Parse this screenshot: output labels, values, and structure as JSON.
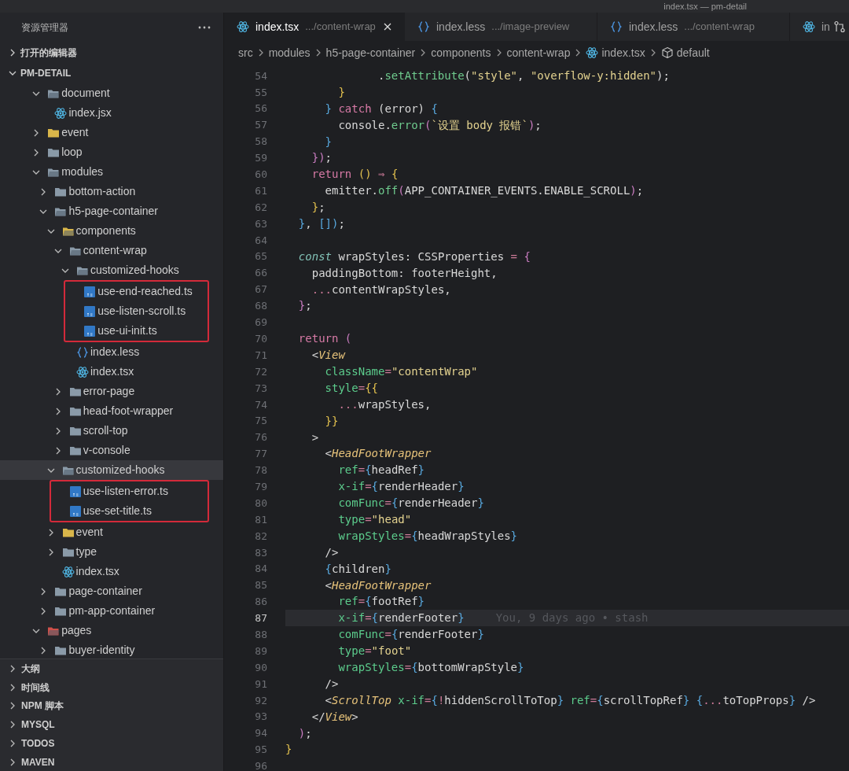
{
  "window": {
    "title": "index.tsx — pm-detail"
  },
  "sidebar": {
    "title": "资源管理器",
    "sections": [
      {
        "label": "打开的编辑器",
        "expanded": false
      },
      {
        "label": "PM-DETAIL",
        "expanded": true
      }
    ],
    "tree": [
      {
        "label": "document",
        "kind": "folder",
        "expanded": true,
        "selected": false,
        "boxed": false,
        "children": [
          {
            "label": "index.jsx",
            "kind": "react-file",
            "selected": false,
            "boxed": false
          }
        ]
      },
      {
        "label": "event",
        "kind": "folder",
        "color": "#d9b64a",
        "expanded": false,
        "selected": false,
        "boxed": false
      },
      {
        "label": "loop",
        "kind": "folder",
        "expanded": false,
        "selected": false,
        "boxed": false
      },
      {
        "label": "modules",
        "kind": "folder",
        "expanded": true,
        "selected": false,
        "boxed": false,
        "children": [
          {
            "label": "bottom-action",
            "kind": "folder",
            "expanded": false,
            "selected": false,
            "boxed": false
          },
          {
            "label": "h5-page-container",
            "kind": "folder",
            "expanded": true,
            "selected": false,
            "boxed": false,
            "children": [
              {
                "label": "components",
                "kind": "folder",
                "color": "#d9b64a",
                "expanded": true,
                "selected": false,
                "boxed": false,
                "children": [
                  {
                    "label": "content-wrap",
                    "kind": "folder",
                    "expanded": true,
                    "selected": false,
                    "boxed": false,
                    "children": [
                      {
                        "label": "customized-hooks",
                        "kind": "folder",
                        "expanded": true,
                        "selected": false,
                        "boxed": false,
                        "children": [
                          {
                            "label": "use-end-reached.ts",
                            "kind": "ts-file",
                            "selected": false,
                            "boxed": true
                          },
                          {
                            "label": "use-listen-scroll.ts",
                            "kind": "ts-file",
                            "selected": false,
                            "boxed": true
                          },
                          {
                            "label": "use-ui-init.ts",
                            "kind": "ts-file",
                            "selected": false,
                            "boxed": true
                          }
                        ]
                      },
                      {
                        "label": "index.less",
                        "kind": "less-file",
                        "selected": false,
                        "boxed": false
                      },
                      {
                        "label": "index.tsx",
                        "kind": "react-file",
                        "selected": false,
                        "boxed": false
                      }
                    ]
                  },
                  {
                    "label": "error-page",
                    "kind": "folder",
                    "expanded": false,
                    "selected": false,
                    "boxed": false
                  },
                  {
                    "label": "head-foot-wrapper",
                    "kind": "folder",
                    "expanded": false,
                    "selected": false,
                    "boxed": false
                  },
                  {
                    "label": "scroll-top",
                    "kind": "folder",
                    "expanded": false,
                    "selected": false,
                    "boxed": false
                  },
                  {
                    "label": "v-console",
                    "kind": "folder",
                    "expanded": false,
                    "selected": false,
                    "boxed": false
                  }
                ]
              },
              {
                "label": "customized-hooks",
                "kind": "folder",
                "expanded": true,
                "selected": true,
                "boxed": false,
                "children": [
                  {
                    "label": "use-listen-error.ts",
                    "kind": "ts-file",
                    "selected": false,
                    "boxed": true
                  },
                  {
                    "label": "use-set-title.ts",
                    "kind": "ts-file",
                    "selected": false,
                    "boxed": true
                  }
                ]
              },
              {
                "label": "event",
                "kind": "folder",
                "color": "#d9b64a",
                "expanded": false,
                "selected": false,
                "boxed": false
              },
              {
                "label": "type",
                "kind": "folder",
                "expanded": false,
                "selected": false,
                "boxed": false
              },
              {
                "label": "index.tsx",
                "kind": "react-file",
                "selected": false,
                "boxed": false
              }
            ]
          },
          {
            "label": "page-container",
            "kind": "folder",
            "expanded": false,
            "selected": false,
            "boxed": false
          },
          {
            "label": "pm-app-container",
            "kind": "folder",
            "expanded": false,
            "selected": false,
            "boxed": false
          }
        ]
      },
      {
        "label": "pages",
        "kind": "folder",
        "color": "#d0504a",
        "expanded": true,
        "selected": false,
        "boxed": false,
        "children": [
          {
            "label": "buyer-identity",
            "kind": "folder",
            "expanded": false,
            "selected": false,
            "boxed": false
          }
        ]
      }
    ],
    "panels": [
      {
        "label": "大纲",
        "expanded": false
      },
      {
        "label": "时间线",
        "expanded": false
      },
      {
        "label": "NPM 脚本",
        "expanded": false
      },
      {
        "label": "MYSQL",
        "expanded": false
      },
      {
        "label": "TODOS",
        "expanded": false
      },
      {
        "label": "MAVEN",
        "expanded": false
      }
    ]
  },
  "editor": {
    "tabs": [
      {
        "label": "index.tsx",
        "description": ".../content-wrap",
        "kind": "react-file",
        "selected": true
      },
      {
        "label": "index.less",
        "description": ".../image-preview",
        "kind": "less-file",
        "selected": false
      },
      {
        "label": "index.less",
        "description": ".../content-wrap",
        "kind": "less-file",
        "selected": false
      },
      {
        "label": "in",
        "kind": "react-file",
        "selected": false
      }
    ],
    "breadcrumb": [
      {
        "label": "src",
        "kind": "folder"
      },
      {
        "label": "modules",
        "kind": "folder"
      },
      {
        "label": "h5-page-container",
        "kind": "folder"
      },
      {
        "label": "components",
        "kind": "folder"
      },
      {
        "label": "content-wrap",
        "kind": "folder"
      },
      {
        "label": "index.tsx",
        "kind": "react-file"
      },
      {
        "label": "default",
        "kind": "symbol"
      }
    ],
    "lines": [
      {
        "number": "54",
        "current": false,
        "tokens": [
          {
            "kind": "plain",
            "text": "              ."
          },
          {
            "kind": "function",
            "text": "setAttribute"
          },
          {
            "kind": "plain",
            "text": "("
          },
          {
            "kind": "string",
            "text": "\"style\""
          },
          {
            "kind": "plain",
            "text": ", "
          },
          {
            "kind": "string",
            "text": "\"overflow-y:hidden\""
          },
          {
            "kind": "plain",
            "text": ");"
          }
        ]
      },
      {
        "number": "55",
        "current": false,
        "tokens": [
          {
            "kind": "bracket1",
            "text": "        }"
          }
        ]
      },
      {
        "number": "56",
        "current": false,
        "tokens": [
          {
            "kind": "bracket2",
            "text": "      }"
          },
          {
            "kind": "keyword",
            "text": " catch"
          },
          {
            "kind": "plain",
            "text": " (error) "
          },
          {
            "kind": "bracket2",
            "text": "{"
          }
        ]
      },
      {
        "number": "57",
        "current": false,
        "tokens": [
          {
            "kind": "plain",
            "text": "        console."
          },
          {
            "kind": "function",
            "text": "error"
          },
          {
            "kind": "bracket3",
            "text": "("
          },
          {
            "kind": "string",
            "text": "`设置 body 报错`"
          },
          {
            "kind": "bracket3",
            "text": ")"
          },
          {
            "kind": "plain",
            "text": ";"
          }
        ]
      },
      {
        "number": "58",
        "current": false,
        "tokens": [
          {
            "kind": "bracket2",
            "text": "      }"
          }
        ]
      },
      {
        "number": "59",
        "current": false,
        "tokens": [
          {
            "kind": "bracket3",
            "text": "    })"
          },
          {
            "kind": "plain",
            "text": ";"
          }
        ]
      },
      {
        "number": "60",
        "current": false,
        "tokens": [
          {
            "kind": "keyword",
            "text": "    return"
          },
          {
            "kind": "bracket1",
            "text": " ()"
          },
          {
            "kind": "operator",
            "text": " ⇒"
          },
          {
            "kind": "bracket1",
            "text": " {"
          }
        ]
      },
      {
        "number": "61",
        "current": false,
        "tokens": [
          {
            "kind": "plain",
            "text": "      emitter."
          },
          {
            "kind": "function",
            "text": "off"
          },
          {
            "kind": "bracket3",
            "text": "("
          },
          {
            "kind": "plain",
            "text": "APP_CONTAINER_EVENTS.ENABLE_SCROLL"
          },
          {
            "kind": "bracket3",
            "text": ")"
          },
          {
            "kind": "plain",
            "text": ";"
          }
        ]
      },
      {
        "number": "62",
        "current": false,
        "tokens": [
          {
            "kind": "bracket1",
            "text": "    }"
          },
          {
            "kind": "plain",
            "text": ";"
          }
        ]
      },
      {
        "number": "63",
        "current": false,
        "tokens": [
          {
            "kind": "bracket2",
            "text": "  }"
          },
          {
            "kind": "plain",
            "text": ","
          },
          {
            "kind": "bracket2",
            "text": " [])"
          },
          {
            "kind": "plain",
            "text": ";"
          }
        ]
      },
      {
        "number": "64",
        "current": false
      },
      {
        "number": "65",
        "current": false,
        "tokens": [
          {
            "kind": "storage",
            "text": "  const"
          },
          {
            "kind": "plain",
            "text": " wrapStyles: CSSProperties"
          },
          {
            "kind": "operator",
            "text": " ="
          },
          {
            "kind": "bracket3",
            "text": " {"
          }
        ]
      },
      {
        "number": "66",
        "current": false,
        "tokens": [
          {
            "kind": "plain",
            "text": "    paddingBottom: footerHeight,"
          }
        ]
      },
      {
        "number": "67",
        "current": false,
        "tokens": [
          {
            "kind": "operator",
            "text": "    ..."
          },
          {
            "kind": "plain",
            "text": "contentWrapStyles,"
          }
        ]
      },
      {
        "number": "68",
        "current": false,
        "tokens": [
          {
            "kind": "bracket3",
            "text": "  }"
          },
          {
            "kind": "plain",
            "text": ";"
          }
        ]
      },
      {
        "number": "69",
        "current": false
      },
      {
        "number": "70",
        "current": false,
        "tokens": [
          {
            "kind": "keyword",
            "text": "  return"
          },
          {
            "kind": "bracket3",
            "text": " ("
          }
        ]
      },
      {
        "number": "71",
        "current": false,
        "tokens": [
          {
            "kind": "plain",
            "text": "    <"
          },
          {
            "kind": "component",
            "text": "View"
          }
        ]
      },
      {
        "number": "72",
        "current": false,
        "tokens": [
          {
            "kind": "attribute",
            "text": "      className"
          },
          {
            "kind": "operator",
            "text": "="
          },
          {
            "kind": "string",
            "text": "\"contentWrap\""
          }
        ]
      },
      {
        "number": "73",
        "current": false,
        "tokens": [
          {
            "kind": "attribute",
            "text": "      style"
          },
          {
            "kind": "operator",
            "text": "="
          },
          {
            "kind": "bracket1",
            "text": "{{"
          }
        ]
      },
      {
        "number": "74",
        "current": false,
        "tokens": [
          {
            "kind": "operator",
            "text": "        ..."
          },
          {
            "kind": "plain",
            "text": "wrapStyles,"
          }
        ]
      },
      {
        "number": "75",
        "current": false,
        "tokens": [
          {
            "kind": "bracket1",
            "text": "      }}"
          }
        ]
      },
      {
        "number": "76",
        "current": false,
        "tokens": [
          {
            "kind": "plain",
            "text": "    >"
          }
        ]
      },
      {
        "number": "77",
        "current": false,
        "tokens": [
          {
            "kind": "plain",
            "text": "      <"
          },
          {
            "kind": "component",
            "text": "HeadFootWrapper"
          }
        ]
      },
      {
        "number": "78",
        "current": false,
        "tokens": [
          {
            "kind": "attribute",
            "text": "        ref"
          },
          {
            "kind": "operator",
            "text": "="
          },
          {
            "kind": "bracket2",
            "text": "{"
          },
          {
            "kind": "plain",
            "text": "headRef"
          },
          {
            "kind": "bracket2",
            "text": "}"
          }
        ]
      },
      {
        "number": "79",
        "current": false,
        "tokens": [
          {
            "kind": "attribute",
            "text": "        x-if"
          },
          {
            "kind": "operator",
            "text": "="
          },
          {
            "kind": "bracket2",
            "text": "{"
          },
          {
            "kind": "plain",
            "text": "renderHeader"
          },
          {
            "kind": "bracket2",
            "text": "}"
          }
        ]
      },
      {
        "number": "80",
        "current": false,
        "tokens": [
          {
            "kind": "attribute",
            "text": "        comFunc"
          },
          {
            "kind": "operator",
            "text": "="
          },
          {
            "kind": "bracket2",
            "text": "{"
          },
          {
            "kind": "plain",
            "text": "renderHeader"
          },
          {
            "kind": "bracket2",
            "text": "}"
          }
        ]
      },
      {
        "number": "81",
        "current": false,
        "tokens": [
          {
            "kind": "attribute",
            "text": "        type"
          },
          {
            "kind": "operator",
            "text": "="
          },
          {
            "kind": "string",
            "text": "\"head\""
          }
        ]
      },
      {
        "number": "82",
        "current": false,
        "tokens": [
          {
            "kind": "attribute",
            "text": "        wrapStyles"
          },
          {
            "kind": "operator",
            "text": "="
          },
          {
            "kind": "bracket2",
            "text": "{"
          },
          {
            "kind": "plain",
            "text": "headWrapStyles"
          },
          {
            "kind": "bracket2",
            "text": "}"
          }
        ]
      },
      {
        "number": "83",
        "current": false,
        "tokens": [
          {
            "kind": "plain",
            "text": "      />"
          }
        ]
      },
      {
        "number": "84",
        "current": false,
        "tokens": [
          {
            "kind": "bracket2",
            "text": "      {"
          },
          {
            "kind": "plain",
            "text": "children"
          },
          {
            "kind": "bracket2",
            "text": "}"
          }
        ]
      },
      {
        "number": "85",
        "current": false,
        "tokens": [
          {
            "kind": "plain",
            "text": "      <"
          },
          {
            "kind": "component",
            "text": "HeadFootWrapper"
          }
        ]
      },
      {
        "number": "86",
        "current": false,
        "tokens": [
          {
            "kind": "attribute",
            "text": "        ref"
          },
          {
            "kind": "operator",
            "text": "="
          },
          {
            "kind": "bracket2",
            "text": "{"
          },
          {
            "kind": "plain",
            "text": "footRef"
          },
          {
            "kind": "bracket2",
            "text": "}"
          }
        ]
      },
      {
        "number": "87",
        "current": true,
        "blame": "You, 9 days ago • stash",
        "tokens": [
          {
            "kind": "attribute",
            "text": "        x-if"
          },
          {
            "kind": "operator",
            "text": "="
          },
          {
            "kind": "bracket2",
            "text": "{"
          },
          {
            "kind": "plain",
            "text": "renderFooter"
          },
          {
            "kind": "bracket2",
            "text": "}"
          }
        ]
      },
      {
        "number": "88",
        "current": false,
        "tokens": [
          {
            "kind": "attribute",
            "text": "        comFunc"
          },
          {
            "kind": "operator",
            "text": "="
          },
          {
            "kind": "bracket2",
            "text": "{"
          },
          {
            "kind": "plain",
            "text": "renderFooter"
          },
          {
            "kind": "bracket2",
            "text": "}"
          }
        ]
      },
      {
        "number": "89",
        "current": false,
        "tokens": [
          {
            "kind": "attribute",
            "text": "        type"
          },
          {
            "kind": "operator",
            "text": "="
          },
          {
            "kind": "string",
            "text": "\"foot\""
          }
        ]
      },
      {
        "number": "90",
        "current": false,
        "tokens": [
          {
            "kind": "attribute",
            "text": "        wrapStyles"
          },
          {
            "kind": "operator",
            "text": "="
          },
          {
            "kind": "bracket2",
            "text": "{"
          },
          {
            "kind": "plain",
            "text": "bottomWrapStyle"
          },
          {
            "kind": "bracket2",
            "text": "}"
          }
        ]
      },
      {
        "number": "91",
        "current": false,
        "tokens": [
          {
            "kind": "plain",
            "text": "      />"
          }
        ]
      },
      {
        "number": "92",
        "current": false,
        "tokens": [
          {
            "kind": "plain",
            "text": "      <"
          },
          {
            "kind": "component",
            "text": "ScrollTop"
          },
          {
            "kind": "attribute",
            "text": " x-if"
          },
          {
            "kind": "operator",
            "text": "="
          },
          {
            "kind": "bracket2",
            "text": "{"
          },
          {
            "kind": "operator",
            "text": "!"
          },
          {
            "kind": "plain",
            "text": "hiddenScrollToTop"
          },
          {
            "kind": "bracket2",
            "text": "}"
          },
          {
            "kind": "attribute",
            "text": " ref"
          },
          {
            "kind": "operator",
            "text": "="
          },
          {
            "kind": "bracket2",
            "text": "{"
          },
          {
            "kind": "plain",
            "text": "scrollTopRef"
          },
          {
            "kind": "bracket2",
            "text": "}"
          },
          {
            "kind": "bracket2",
            "text": " {"
          },
          {
            "kind": "operator",
            "text": "..."
          },
          {
            "kind": "plain",
            "text": "toTopProps"
          },
          {
            "kind": "bracket2",
            "text": "}"
          },
          {
            "kind": "plain",
            "text": " />"
          }
        ]
      },
      {
        "number": "93",
        "current": false,
        "tokens": [
          {
            "kind": "plain",
            "text": "    </"
          },
          {
            "kind": "component",
            "text": "View"
          },
          {
            "kind": "plain",
            "text": ">"
          }
        ]
      },
      {
        "number": "94",
        "current": false,
        "tokens": [
          {
            "kind": "bracket3",
            "text": "  )"
          },
          {
            "kind": "plain",
            "text": ";"
          }
        ]
      },
      {
        "number": "95",
        "current": false,
        "tokens": [
          {
            "kind": "bracket1",
            "text": "}"
          }
        ]
      },
      {
        "number": "96",
        "current": false
      }
    ]
  }
}
